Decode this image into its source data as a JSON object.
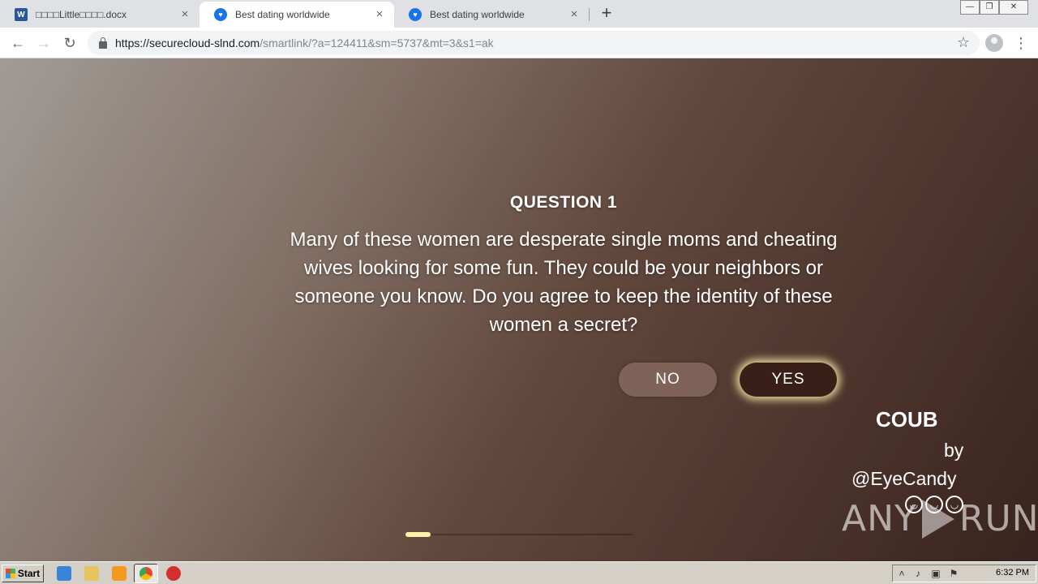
{
  "browser": {
    "tabs": [
      {
        "title": "□□□□Little□□□□.docx",
        "favicon": "word-icon",
        "active": false
      },
      {
        "title": "Best dating worldwide",
        "favicon": "heart-shield-icon",
        "active": true
      },
      {
        "title": "Best dating worldwide",
        "favicon": "heart-shield-icon",
        "active": false
      }
    ],
    "new_tab_symbol": "+",
    "close_symbol": "×",
    "address": {
      "url_host": "https://securecloud-slnd.com",
      "url_rest": "/smartlink/?a=124411&sm=5737&mt=3&s1=ak"
    }
  },
  "page": {
    "question_title": "QUESTION 1",
    "question_text": "Many of these women are desperate single moms and cheating wives looking for some fun. They could be your neighbors or someone you know. Do you agree to keep the identity of these women a secret?",
    "no_label": "NO",
    "yes_label": "YES",
    "coub_logo": "COUB",
    "coub_by": "by",
    "coub_author": "@EyeCandy",
    "progress": 0.11,
    "watermark_left": "ANY",
    "watermark_right": "RUN"
  },
  "taskbar": {
    "start_label": "Start",
    "clock": "6:32 PM"
  },
  "colors": {
    "yes_button": "#3a1e18",
    "yes_glow": "#fff0aa",
    "progress_fill": "#fff3a8"
  }
}
